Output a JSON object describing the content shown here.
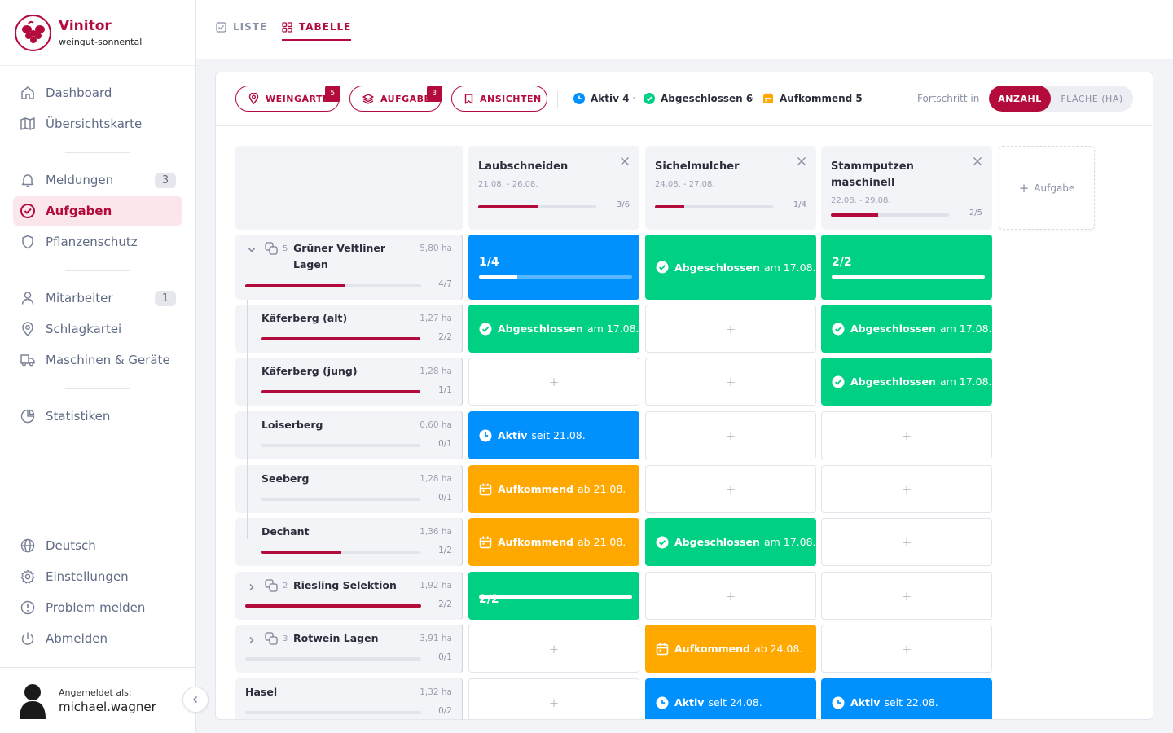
{
  "brand": {
    "name": "Vinitor",
    "tenant": "weingut-sonnental",
    "color": "#b30b3c"
  },
  "nav": {
    "items": [
      {
        "label": "Dashboard",
        "icon": "home-icon"
      },
      {
        "label": "Übersichtskarte",
        "icon": "map-icon"
      },
      {
        "label": "Meldungen",
        "icon": "bell-icon",
        "badge": "3"
      },
      {
        "label": "Aufgaben",
        "icon": "check-circle-icon",
        "active": true
      },
      {
        "label": "Pflanzenschutz",
        "icon": "shield-icon"
      },
      {
        "label": "Mitarbeiter",
        "icon": "user-icon",
        "badge": "1"
      },
      {
        "label": "Schlagkartei",
        "icon": "map-pin-icon"
      },
      {
        "label": "Maschinen & Geräte",
        "icon": "truck-icon"
      },
      {
        "label": "Statistiken",
        "icon": "pie-chart-icon"
      }
    ],
    "footer": [
      {
        "label": "Deutsch",
        "icon": "globe-icon"
      },
      {
        "label": "Einstellungen",
        "icon": "gear-icon"
      },
      {
        "label": "Problem melden",
        "icon": "alert-icon"
      },
      {
        "label": "Abmelden",
        "icon": "power-icon"
      }
    ]
  },
  "user": {
    "label": "Angemeldet als:",
    "name": "michael.wagner"
  },
  "view_tabs": {
    "list": "LISTE",
    "table": "TABELLE",
    "active": "table"
  },
  "toolbar": {
    "filters": [
      {
        "label": "WEINGÄRTEN",
        "badge": "5",
        "icon": "map-pin-icon"
      },
      {
        "label": "AUFGABEN",
        "badge": "3",
        "icon": "layers-icon"
      },
      {
        "label": "ANSICHTEN",
        "badge": "",
        "icon": "bookmark-icon"
      }
    ],
    "stats": [
      {
        "label": "Aktiv 4",
        "color": "#0091ff",
        "icon": "clock-icon"
      },
      {
        "label": "Abgeschlossen 6",
        "color": "#00d084",
        "icon": "check-circle-icon"
      },
      {
        "label": "Aufkommend 5",
        "color": "#ffa800",
        "icon": "calendar-icon"
      }
    ],
    "progress_label": "Fortschritt in",
    "progress_options": [
      "ANZAHL",
      "FLÄCHE (HA)"
    ],
    "progress_selected": "ANZAHL"
  },
  "tasks": [
    {
      "name": "Laubschneiden",
      "dates": "21.08. - 26.08.",
      "count": "3/6",
      "progress": 0.5
    },
    {
      "name": "Sichelmulcher",
      "dates": "24.08. - 27.08.",
      "count": "1/4",
      "progress": 0.25
    },
    {
      "name": "Stammputzen maschinell",
      "dates": "22.08. - 29.08.",
      "count": "2/5",
      "progress": 0.4
    }
  ],
  "add_task_label": "Aufgabe",
  "rows": [
    {
      "name": "Grüner Veltliner Lagen",
      "area": "5,80 ha",
      "count": "4/7",
      "progress": 0.571,
      "group": true,
      "group_count": "5",
      "expanded": true,
      "cells": [
        {
          "type": "frac",
          "color": "blue",
          "text": "1/4",
          "progress": 0.25
        },
        {
          "type": "done",
          "color": "green",
          "label": "Abgeschlossen",
          "date": "am 17.08."
        },
        {
          "type": "frac",
          "color": "green",
          "text": "2/2",
          "progress": 1
        }
      ]
    },
    {
      "name": "Käferberg (alt)",
      "area": "1,27 ha",
      "count": "2/2",
      "progress": 1,
      "child": true,
      "cells": [
        {
          "type": "done",
          "color": "green",
          "label": "Abgeschlossen",
          "date": "am 17.08."
        },
        {
          "type": "empty"
        },
        {
          "type": "done",
          "color": "green",
          "label": "Abgeschlossen",
          "date": "am 17.08."
        }
      ]
    },
    {
      "name": "Käferberg (jung)",
      "area": "1,28 ha",
      "count": "1/1",
      "progress": 1,
      "child": true,
      "cells": [
        {
          "type": "empty"
        },
        {
          "type": "empty"
        },
        {
          "type": "done",
          "color": "green",
          "label": "Abgeschlossen",
          "date": "am 17.08."
        }
      ]
    },
    {
      "name": "Loiserberg",
      "area": "0,60 ha",
      "count": "0/1",
      "progress": 0,
      "child": true,
      "cells": [
        {
          "type": "active",
          "color": "blue",
          "label": "Aktiv",
          "date": "seit 21.08."
        },
        {
          "type": "empty"
        },
        {
          "type": "empty"
        }
      ]
    },
    {
      "name": "Seeberg",
      "area": "1,28 ha",
      "count": "0/1",
      "progress": 0,
      "child": true,
      "cells": [
        {
          "type": "upcoming",
          "color": "orange",
          "label": "Aufkommend",
          "date": "ab 21.08."
        },
        {
          "type": "empty"
        },
        {
          "type": "empty"
        }
      ]
    },
    {
      "name": "Dechant",
      "area": "1,36 ha",
      "count": "1/2",
      "progress": 0.5,
      "child": true,
      "last_child": true,
      "cells": [
        {
          "type": "upcoming",
          "color": "orange",
          "label": "Aufkommend",
          "date": "ab 21.08."
        },
        {
          "type": "done",
          "color": "green",
          "label": "Abgeschlossen",
          "date": "am 17.08."
        },
        {
          "type": "empty"
        }
      ]
    },
    {
      "name": "Riesling Selektion",
      "area": "1,92 ha",
      "count": "2/2",
      "progress": 1,
      "group": true,
      "group_count": "2",
      "cells": [
        {
          "type": "frac",
          "color": "green",
          "text": "2/2",
          "progress": 1
        },
        {
          "type": "empty"
        },
        {
          "type": "empty"
        }
      ]
    },
    {
      "name": "Rotwein Lagen",
      "area": "3,91 ha",
      "count": "0/1",
      "progress": 0,
      "group": true,
      "group_count": "3",
      "cells": [
        {
          "type": "empty"
        },
        {
          "type": "upcoming",
          "color": "orange",
          "label": "Aufkommend",
          "date": "ab 24.08."
        },
        {
          "type": "empty"
        }
      ]
    },
    {
      "name": "Hasel",
      "area": "1,32 ha",
      "count": "0/2",
      "progress": 0,
      "cells": [
        {
          "type": "empty"
        },
        {
          "type": "active",
          "color": "blue",
          "label": "Aktiv",
          "date": "seit 24.08."
        },
        {
          "type": "active",
          "color": "blue",
          "label": "Aktiv",
          "date": "seit 22.08."
        }
      ]
    }
  ]
}
